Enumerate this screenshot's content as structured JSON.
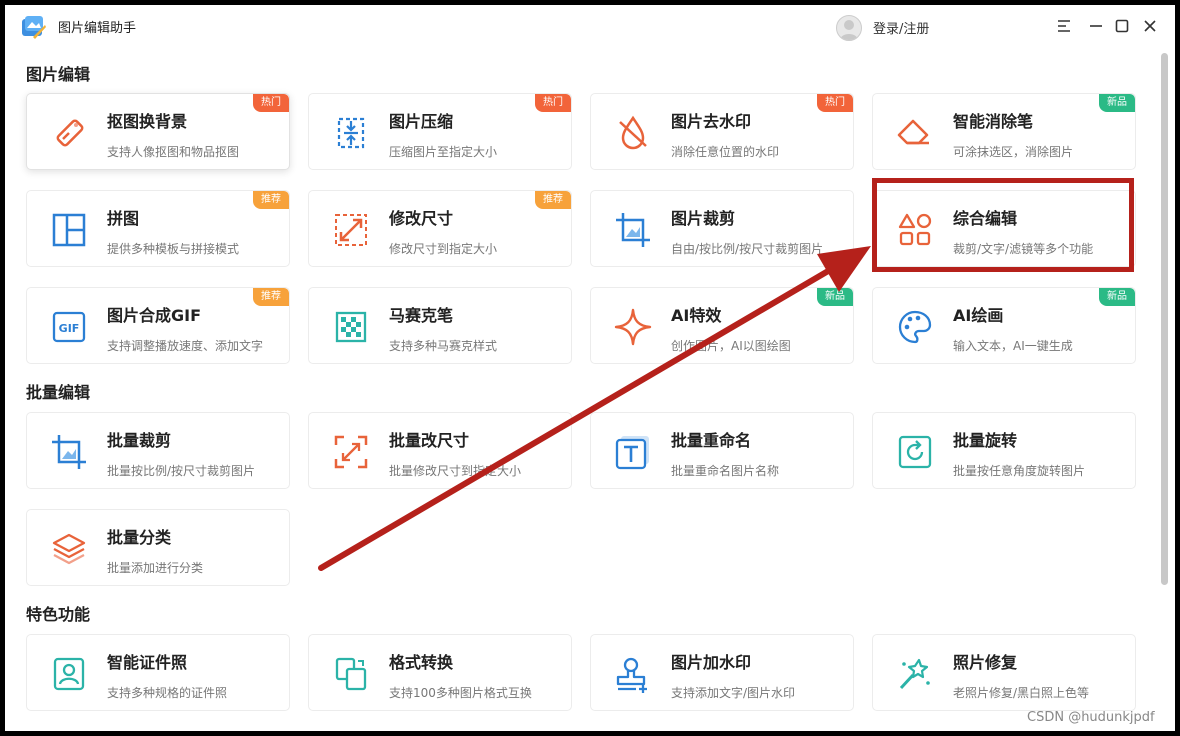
{
  "app": {
    "name": "图片编辑助手",
    "login_label": "登录/注册"
  },
  "sections": {
    "edit": {
      "title": "图片编辑"
    },
    "batch": {
      "title": "批量编辑"
    },
    "special": {
      "title": "特色功能"
    }
  },
  "cards": {
    "cutout": {
      "title": "抠图换背景",
      "desc": "支持人像抠图和物品抠图",
      "badge": "热门"
    },
    "compress": {
      "title": "图片压缩",
      "desc": "压缩图片至指定大小",
      "badge": "热门"
    },
    "watermark_remove": {
      "title": "图片去水印",
      "desc": "消除任意位置的水印",
      "badge": "热门"
    },
    "eraser": {
      "title": "智能消除笔",
      "desc": "可涂抹选区，消除图片",
      "badge": "新品"
    },
    "collage": {
      "title": "拼图",
      "desc": "提供多种模板与拼接模式",
      "badge": "推荐"
    },
    "resize": {
      "title": "修改尺寸",
      "desc": "修改尺寸到指定大小",
      "badge": "推荐"
    },
    "crop": {
      "title": "图片裁剪",
      "desc": "自由/按比例/按尺寸裁剪图片"
    },
    "comprehensive": {
      "title": "综合编辑",
      "desc": "裁剪/文字/滤镜等多个功能"
    },
    "gif": {
      "title": "图片合成GIF",
      "desc": "支持调整播放速度、添加文字",
      "badge": "推荐"
    },
    "mosaic": {
      "title": "马赛克笔",
      "desc": "支持多种马赛克样式"
    },
    "ai_effect": {
      "title": "AI特效",
      "desc": "创作图片，AI以图绘图",
      "badge": "新品"
    },
    "ai_draw": {
      "title": "AI绘画",
      "desc": "输入文本，AI一键生成",
      "badge": "新品"
    },
    "batch_crop": {
      "title": "批量裁剪",
      "desc": "批量按比例/按尺寸裁剪图片"
    },
    "batch_resize": {
      "title": "批量改尺寸",
      "desc": "批量修改尺寸到指定大小"
    },
    "batch_rename": {
      "title": "批量重命名",
      "desc": "批量重命名图片名称"
    },
    "batch_rotate": {
      "title": "批量旋转",
      "desc": "批量按任意角度旋转图片"
    },
    "batch_classify": {
      "title": "批量分类",
      "desc": "批量添加进行分类"
    },
    "id_photo": {
      "title": "智能证件照",
      "desc": "支持多种规格的证件照"
    },
    "format_convert": {
      "title": "格式转换",
      "desc": "支持100多种图片格式互换"
    },
    "add_watermark": {
      "title": "图片加水印",
      "desc": "支持添加文字/图片水印"
    },
    "photo_repair": {
      "title": "照片修复",
      "desc": "老照片修复/黑白照上色等"
    }
  },
  "footer": {
    "watermark": "CSDN @hudunkjpdf"
  },
  "colors": {
    "accent_orange": "#e8633a",
    "accent_blue": "#2b7fd4",
    "accent_teal": "#2bb3a8",
    "annotation_red": "#b5211b"
  }
}
